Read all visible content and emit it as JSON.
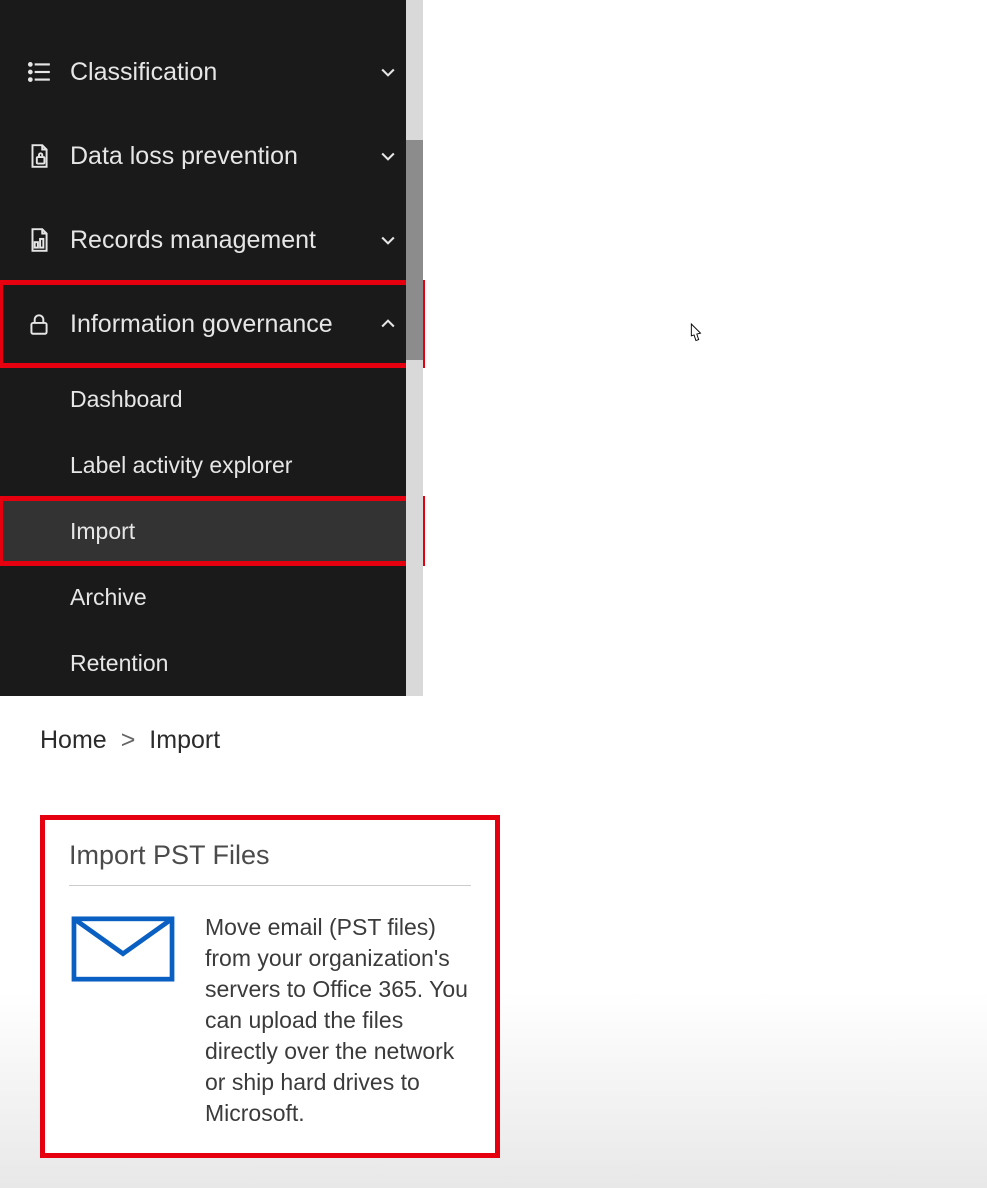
{
  "sidebar": {
    "items": [
      {
        "label": "Classification",
        "icon": "list-icon",
        "expanded": false
      },
      {
        "label": "Data loss prevention",
        "icon": "file-lock-icon",
        "expanded": false
      },
      {
        "label": "Records management",
        "icon": "records-icon",
        "expanded": false
      },
      {
        "label": "Information governance",
        "icon": "lock-icon",
        "expanded": true,
        "children": [
          {
            "label": "Dashboard",
            "selected": false
          },
          {
            "label": "Label activity explorer",
            "selected": false
          },
          {
            "label": "Import",
            "selected": true
          },
          {
            "label": "Archive",
            "selected": false
          },
          {
            "label": "Retention",
            "selected": false
          }
        ]
      }
    ]
  },
  "breadcrumb": {
    "home": "Home",
    "sep": ">",
    "current": "Import"
  },
  "card": {
    "title": "Import PST Files",
    "body": "Move email (PST files) from your organization's servers to Office 365. You can upload the files directly over the network or ship hard drives to Microsoft."
  }
}
